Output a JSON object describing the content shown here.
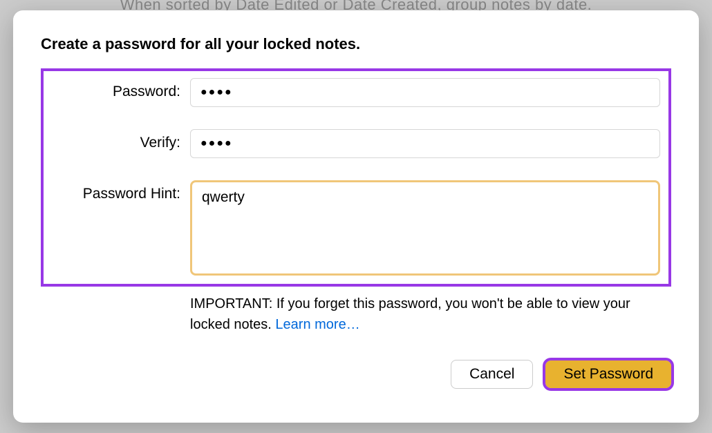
{
  "background_text": "When sorted by Date Edited or Date Created, group notes by date.",
  "dialog": {
    "title": "Create a password for all your locked notes.",
    "labels": {
      "password": "Password:",
      "verify": "Verify:",
      "hint": "Password Hint:"
    },
    "values": {
      "password": "●●●●",
      "verify": "●●●●",
      "hint": "qwerty"
    },
    "important_prefix": "IMPORTANT: If you forget this password, you won't be able to view your locked notes. ",
    "learn_more": "Learn more…",
    "buttons": {
      "cancel": "Cancel",
      "set": "Set Password"
    }
  }
}
